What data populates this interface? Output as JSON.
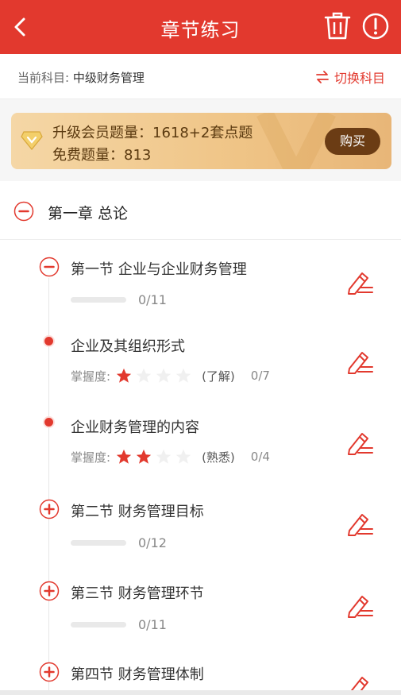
{
  "header": {
    "title": "章节练习"
  },
  "subject": {
    "label": "当前科目: ",
    "value": "中级财务管理",
    "switch_label": "切换科目"
  },
  "banner": {
    "line1": "升级会员题量：1618+2套点题",
    "line2": "免费题量：813",
    "buy_label": "购买"
  },
  "chapter": {
    "title": "第一章 总论"
  },
  "items": [
    {
      "kind": "section",
      "title": "第一节 企业与企业财务管理",
      "count": "0/11"
    },
    {
      "kind": "point",
      "title": "企业及其组织形式",
      "mastery_label": "掌握度:",
      "stars": 1,
      "level": "(了解)",
      "count": "0/7"
    },
    {
      "kind": "point",
      "title": "企业财务管理的内容",
      "mastery_label": "掌握度:",
      "stars": 2,
      "level": "(熟悉)",
      "count": "0/4"
    },
    {
      "kind": "section",
      "title": "第二节 财务管理目标",
      "count": "0/12"
    },
    {
      "kind": "section",
      "title": "第三节 财务管理环节",
      "count": "0/11"
    },
    {
      "kind": "section",
      "title": "第四节 财务管理体制",
      "count": ""
    }
  ],
  "colors": {
    "accent": "#e2392e",
    "banner_text": "#5b3a10",
    "buy_bg": "#6b3c14"
  }
}
